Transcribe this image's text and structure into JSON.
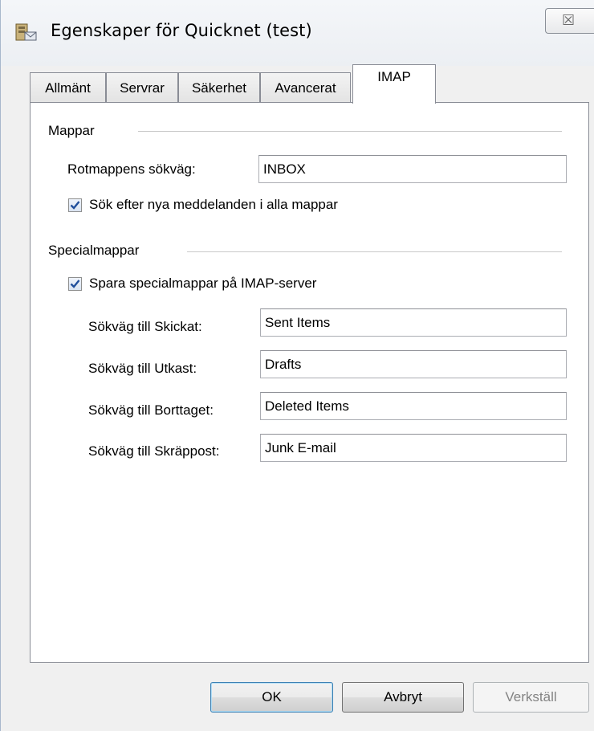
{
  "window": {
    "title": "Egenskaper för Quicknet (test)",
    "app_icon": "mail-account-icon",
    "close_glyph": "☒"
  },
  "tabs": [
    {
      "label": "Allmänt",
      "active": false
    },
    {
      "label": "Servrar",
      "active": false
    },
    {
      "label": "Säkerhet",
      "active": false
    },
    {
      "label": "Avancerat",
      "active": false
    },
    {
      "label": "IMAP",
      "active": true
    }
  ],
  "mappar": {
    "heading": "Mappar",
    "root_label": "Rotmappens sökväg:",
    "root_value": "INBOX",
    "check_all_label": "Sök efter nya meddelanden i alla mappar",
    "check_all_checked": true
  },
  "specialmappar": {
    "heading": "Specialmappar",
    "store_on_server_label": "Spara specialmappar på IMAP-server",
    "store_on_server_checked": true,
    "sent_label": "Sökväg till Skickat:",
    "sent_value": "Sent Items",
    "drafts_label": "Sökväg till Utkast:",
    "drafts_value": "Drafts",
    "deleted_label": "Sökväg till Borttaget:",
    "deleted_value": "Deleted Items",
    "junk_label": "Sökväg till Skräppost:",
    "junk_value": "Junk E-mail"
  },
  "buttons": {
    "ok": "OK",
    "cancel": "Avbryt",
    "apply": "Verkställ"
  },
  "colors": {
    "check_mark": "#1f4e9b",
    "disabled_text": "#838383"
  }
}
